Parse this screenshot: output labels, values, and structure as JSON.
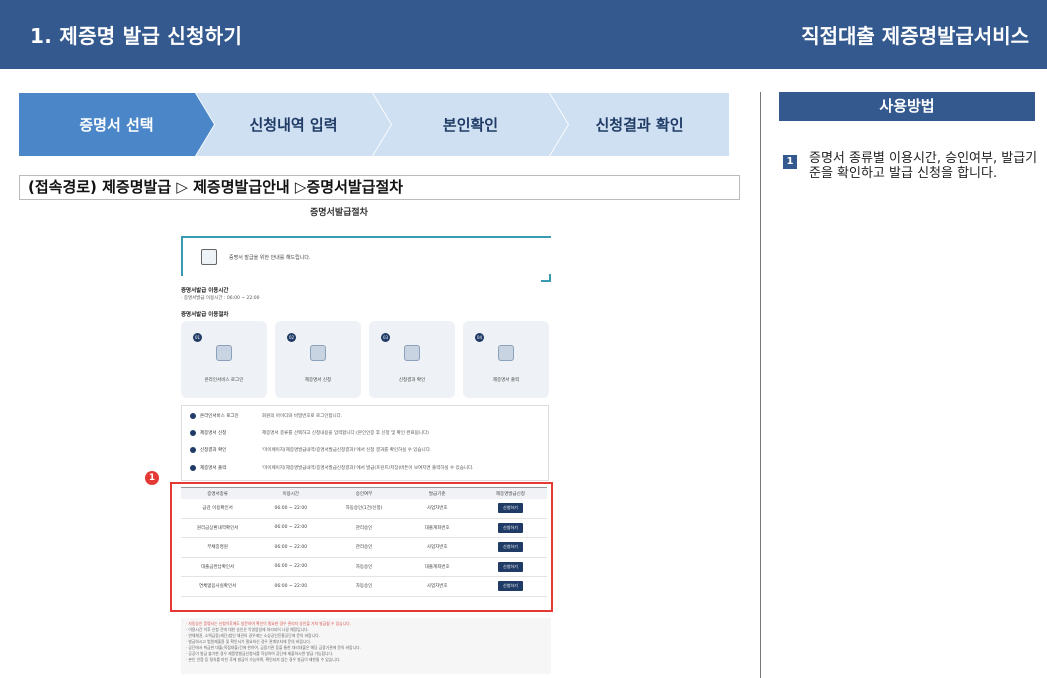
{
  "header": {
    "title": "1. 제증명 발급 신청하기",
    "service": "직접대출 제증명발급서비스"
  },
  "steps": [
    "증명서 선택",
    "신청내역 입력",
    "본인확인",
    "신청결과 확인"
  ],
  "route": "(접속경로) 제증명발급 ▷ 제증명발급안내 ▷증명서발급절차",
  "embedded": {
    "title": "증명서발급절차",
    "banner_text": "증명서 발급을 위한 안내를 해드립니다.",
    "hours_title": "증명서발급 이용시간",
    "hours_text": "· 증명서발급 이용시간 : 06:00 ~ 22:00",
    "procedure_title": "증명서발급 이용절차",
    "cards": [
      {
        "num": "01",
        "label": "온라인서비스 로그인"
      },
      {
        "num": "02",
        "label": "제증명서 신청"
      },
      {
        "num": "03",
        "label": "신청결과 확인"
      },
      {
        "num": "04",
        "label": "제증명서 출력"
      }
    ],
    "desc_rows": [
      {
        "label": "온라인서비스 로그인",
        "text": "회원의 아이디와 비밀번호로 로그인합니다."
      },
      {
        "label": "제증명서 신청",
        "text": "제증명서 종류를 선택하고 신청내용을 입력합니다.(본인인증 후 신청 및 확인 완료됩니다)"
      },
      {
        "label": "신청결과 확인",
        "text": "'마이페이지(제증명발급내역/증명서발급신청결과)'에서 신청 결과를 확인하실 수 있습니다."
      },
      {
        "label": "제증명서 출력",
        "text": "'마이페이지(제증명발급내역/증명서발급신청결과)'에서 발급(프린트/저장)버튼이 보여지면 출력하실 수 있습니다."
      }
    ],
    "table": {
      "headers": [
        "증명서종류",
        "이용시간",
        "승인여부",
        "발급기준",
        "제증명발급신청"
      ],
      "rows": [
        [
          "금감 이용확인서",
          "06:00 ~ 22:00",
          "자동승인(1건/신청)",
          "사업자번호",
          "신청하기"
        ],
        [
          "원리금상환내역확인서",
          "06:00 ~ 22:00",
          "관리승인",
          "대출계좌번호",
          "신청하기"
        ],
        [
          "부채증명원",
          "06:00 ~ 22:00",
          "관리승인",
          "사업자번호",
          "신청하기"
        ],
        [
          "대출금완납확인서",
          "06:00 ~ 22:00",
          "자동승인",
          "대출계좌번호",
          "신청하기"
        ],
        [
          "연체없음사실확인서",
          "06:00 ~ 22:00",
          "자동승인",
          "사업자번호",
          "신청하기"
        ]
      ]
    },
    "notes": [
      "· 자동승인 증명서는 신청이후에도 방문하여 확인이 필요한 경우 관리자 승인을 거쳐 발급될 수 있습니다.",
      "· 이용시간 이후 신청 건에 대한 승인은 익영업일에 처리되어 나갈 예정입니다.",
      "· 연체채권, 소액금융(재단)법인 채권의 경우에는 소상공인진흥공단에 문의 바랍니다.",
      "· 발급하시고 법원제출용 및 확인서가 필요하신 경우 관계부처에 문의 바랍니다.",
      "· 공단에서 취급한 대출(직접대출)건에 한하여, 금융기관 등을 통한 대리대출은 해당 금융기관에 문의 바랍니다.",
      "· 공공이 발급 불가한 경우 제증명발급신청서를 작성하여 공단에 제출하시면 발급 가능합니다.",
      "· 본인 인증 등 절차를 마친 후에 발급이 가능하며, 확인되지 않는 경우 발급이 제한될 수 있습니다."
    ]
  },
  "annotation_number": "1",
  "usage": {
    "title": "사용방법",
    "num": "1",
    "text": "증명서 종류별 이용시간, 승인여부, 발급기준을 확인하고 발급 신청을 합니다."
  }
}
